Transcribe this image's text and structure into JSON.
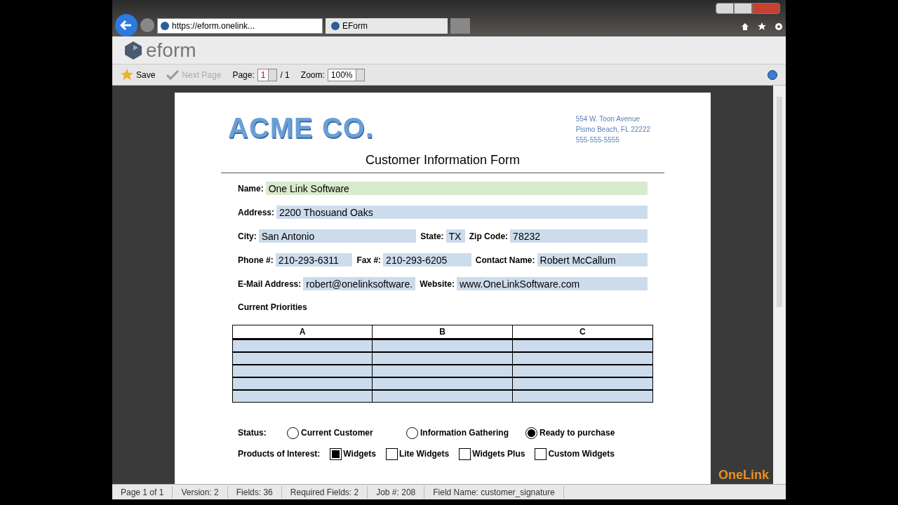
{
  "browser": {
    "address": "https://eform.onelink...",
    "tabs": [
      {
        "label": "EForm",
        "selected": true
      }
    ]
  },
  "app": {
    "logo": "eform",
    "toolbar": {
      "save": "Save",
      "next_page": "Next Page",
      "next_page_disabled": true,
      "page_label": "Page:",
      "page_value": "1",
      "page_total": "/ 1",
      "zoom_label": "Zoom:",
      "zoom_value": "100%"
    }
  },
  "document": {
    "company": "ACME CO.",
    "address_lines": [
      "554 W. Toon Avenue",
      "Pismo Beach, FL 22222",
      "555-555-5555"
    ],
    "title": "Customer Information Form",
    "field_rows": [
      [
        {
          "label": "Name:",
          "value": "One Link Software",
          "focused": true
        }
      ],
      [
        {
          "label": "Address:",
          "value": "2200 Thosuand Oaks",
          "focused": false
        }
      ],
      [
        {
          "label": "City:",
          "value": "San Antonio",
          "focused": false
        },
        {
          "label": "State:",
          "value": "TX",
          "focused": false
        },
        {
          "label": "Zip Code:",
          "value": "78232",
          "focused": false
        }
      ],
      [
        {
          "label": "Phone #:",
          "value": "210-293-6311",
          "focused": false
        },
        {
          "label": "Fax #:",
          "value": "210-293-6205",
          "focused": false
        },
        {
          "label": "Contact Name:",
          "value": "Robert McCallum",
          "focused": false
        }
      ],
      [
        {
          "label": "E-Mail Address:",
          "value": "robert@onelinksoftware.",
          "focused": false
        },
        {
          "label": "Website:",
          "value": "www.OneLinkSoftware.com",
          "focused": false
        }
      ]
    ],
    "priorities": {
      "label": "Current Priorities",
      "columns": [
        "A",
        "B",
        "C"
      ]
    },
    "status": {
      "label": "Status:",
      "options": [
        {
          "label": "Current Customer",
          "selected": false
        },
        {
          "label": "Information Gathering",
          "selected": false
        },
        {
          "label": "Ready to purchase",
          "selected": true
        }
      ]
    },
    "products": {
      "label": "Products of Interest:",
      "options": [
        {
          "label": "Widgets",
          "checked": true
        },
        {
          "label": "Lite Widgets",
          "checked": false
        },
        {
          "label": "Widgets Plus",
          "checked": false
        },
        {
          "label": "Custom Widgets",
          "checked": false
        }
      ]
    }
  },
  "status_bar": [
    "Page 1 of 1",
    "Version: 2",
    "Fields: 36",
    "Required Fields: 2",
    "Job #: 208",
    "Field Name: customer_signature"
  ],
  "brand": {
    "one": "One",
    "link": "Link"
  }
}
